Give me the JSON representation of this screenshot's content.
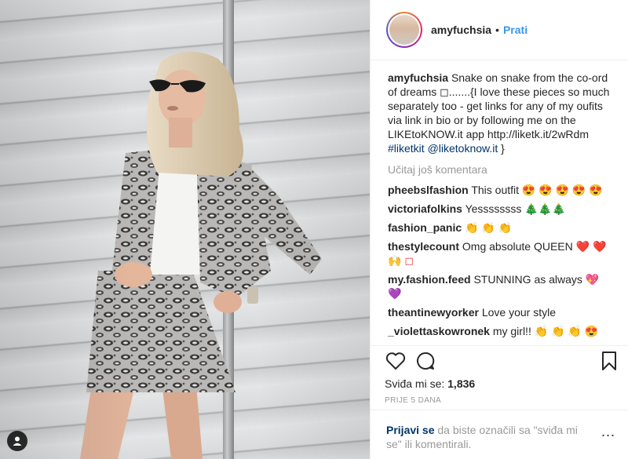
{
  "post": {
    "username": "amyfuchsia",
    "dot": "•",
    "follow_label": "Prati",
    "caption_user": "amyfuchsia",
    "caption_text": "Snake on snake from the co-ord of dreams ◻.......{I love these pieces so much separately too - get links for any of my oufits via link in bio or by following me on the LIKEtoKNOW.it app http://liketk.it/2wRdm",
    "caption_hashtag": "#liketkit",
    "caption_mention": "@liketoknow.it",
    "caption_end": "}",
    "load_more": "Učitaj još komentara",
    "comments": [
      {
        "user": "pheebslfashion",
        "text": "This outfit",
        "emoji": "😍 😍 😍 😍 😍"
      },
      {
        "user": "victoriafolkins",
        "text": "Yessssssss",
        "emoji": "🎄🎄🎄"
      },
      {
        "user": "fashion_panic",
        "text": "",
        "emoji": "👏 👏 👏"
      },
      {
        "user": "thestylecount",
        "text": "Omg absolute QUEEN",
        "emoji": "❤️ ❤️ 🙌 ◻"
      },
      {
        "user": "my.fashion.feed",
        "text": "STUNNING as always",
        "emoji": "💖 💜"
      },
      {
        "user": "theantinewyorker",
        "text": "Love your style",
        "emoji": ""
      },
      {
        "user": "_violettaskowronek",
        "text": "my girl!!",
        "emoji": "👏 👏 👏 😍"
      }
    ],
    "likes_label": "Sviđa mi se:",
    "likes_count": "1,836",
    "time_ago": "PRIJE 5 DANA",
    "login_link": "Prijavi se",
    "login_text": "da biste označili sa \"sviđa mi se\" ili komentirali.",
    "more_label": "..."
  },
  "icons": {
    "like": "heart-icon",
    "comment": "comment-icon",
    "save": "bookmark-icon",
    "user_tag": "user-tag-icon"
  },
  "colors": {
    "link_blue": "#3897f0",
    "tag_navy": "#003569",
    "muted": "#999999"
  }
}
